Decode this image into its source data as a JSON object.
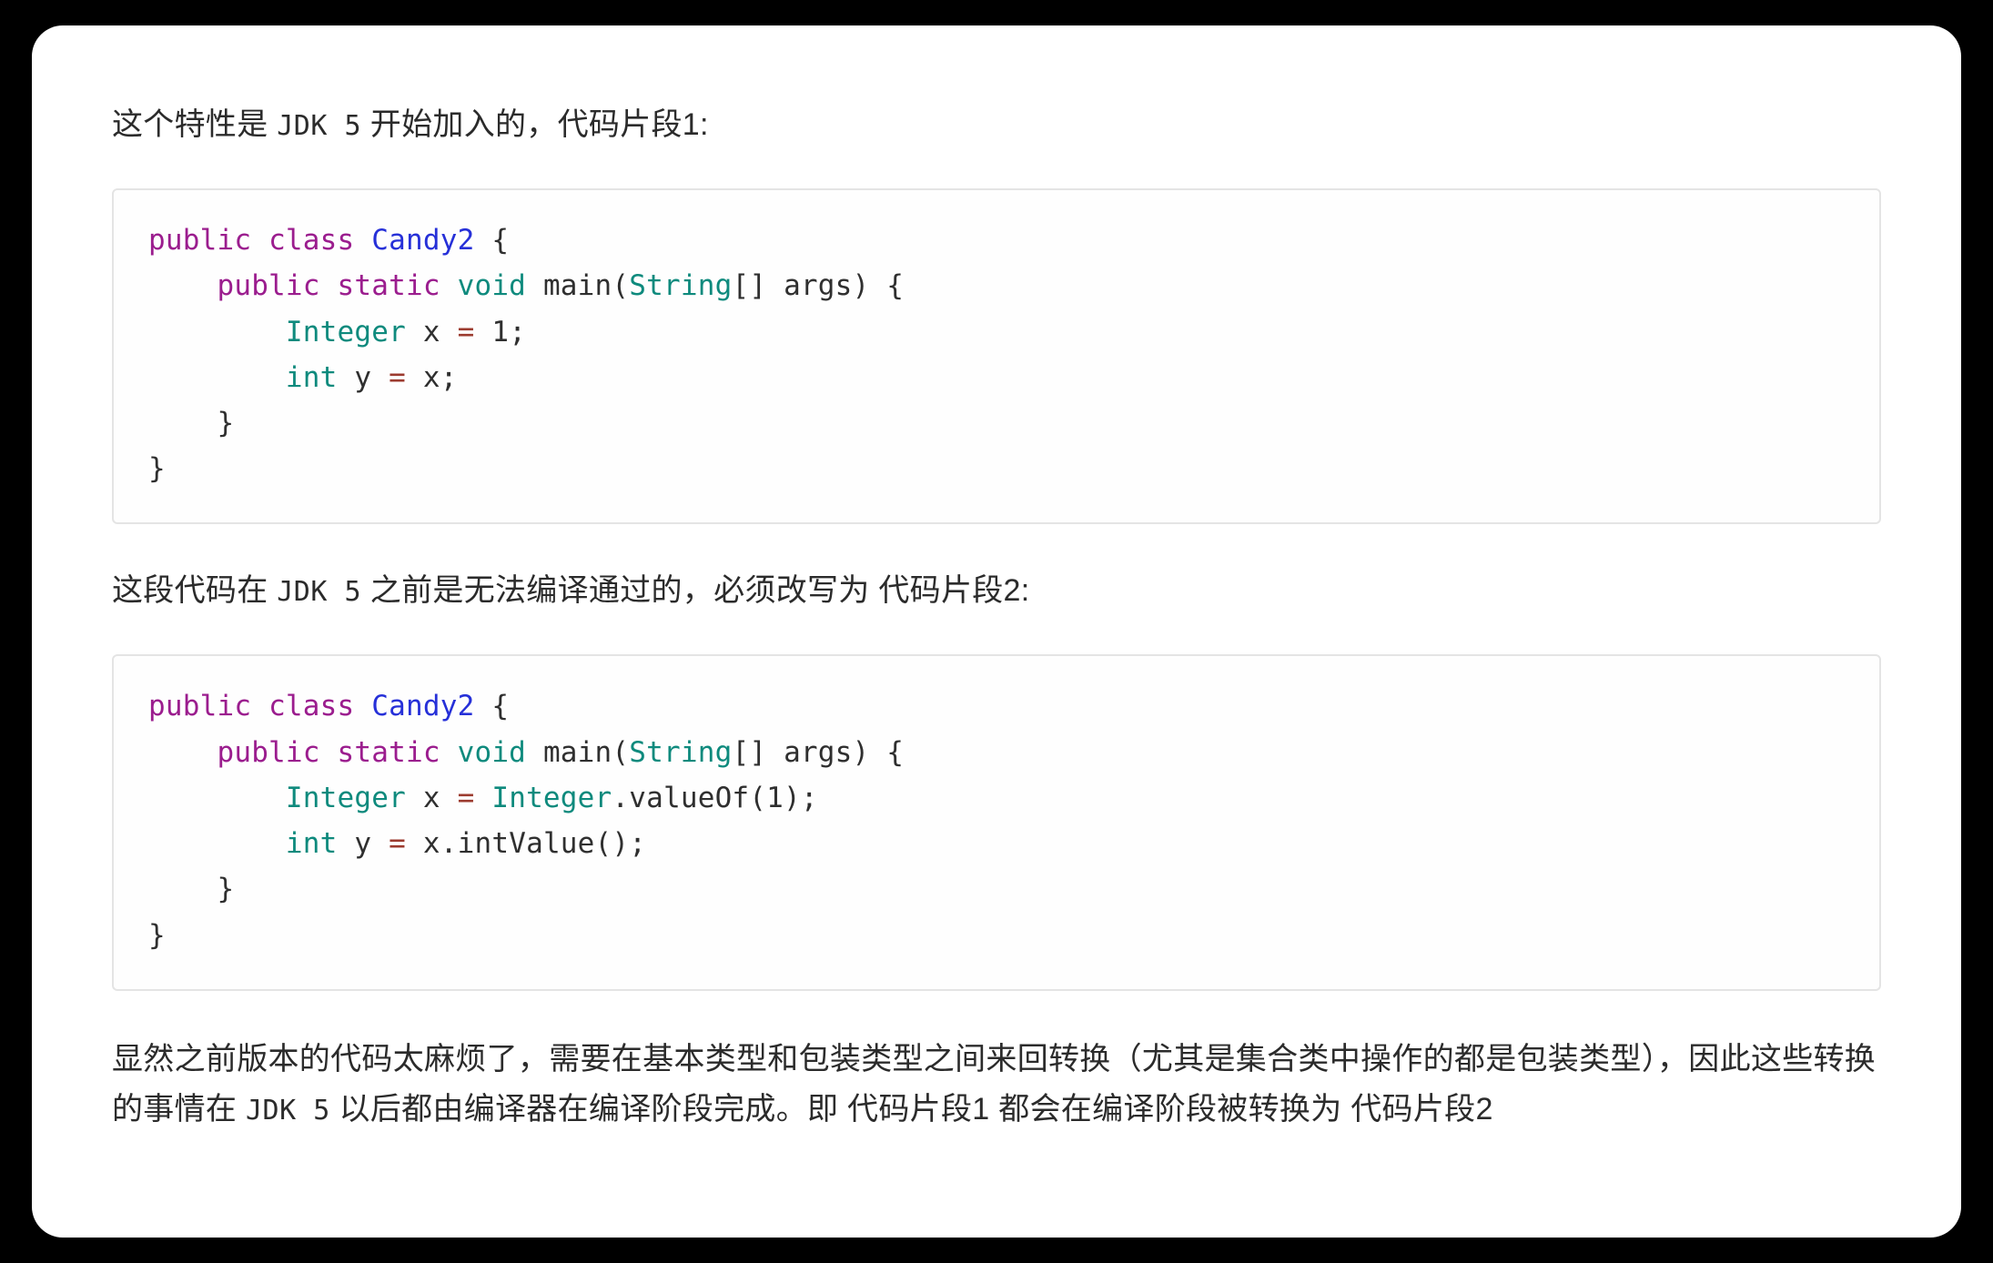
{
  "page": {
    "background_color": "#000000",
    "card_color": "#ffffff"
  },
  "paragraphs": {
    "intro": {
      "part1": "这个特性是 ",
      "mono1": "JDK 5",
      "part2": " 开始加入的，代码片段1:"
    },
    "middle": {
      "part1": "这段代码在 ",
      "mono1": "JDK 5",
      "part2": " 之前是无法编译通过的，必须改写为 代码片段2:"
    },
    "last": {
      "part1": "显然之前版本的代码太麻烦了，需要在基本类型和包装类型之间来回转换（尤其是集合类中操作的都是包装类型），因此这些转换的事情在 ",
      "mono1": "JDK 5",
      "part2": " 以后都由编译器在编译阶段完成。即 代码片段1 都会在编译阶段被转换为 代码片段2"
    }
  },
  "code_block_1": {
    "language": "java",
    "lines": [
      [
        {
          "t": "public",
          "c": "kw"
        },
        {
          "t": " ",
          "c": "plain"
        },
        {
          "t": "class",
          "c": "kw"
        },
        {
          "t": " ",
          "c": "plain"
        },
        {
          "t": "Candy2",
          "c": "cls"
        },
        {
          "t": " {",
          "c": "plain"
        }
      ],
      [
        {
          "t": "    ",
          "c": "plain"
        },
        {
          "t": "public",
          "c": "kw"
        },
        {
          "t": " ",
          "c": "plain"
        },
        {
          "t": "static",
          "c": "kw"
        },
        {
          "t": " ",
          "c": "plain"
        },
        {
          "t": "void",
          "c": "type"
        },
        {
          "t": " ",
          "c": "plain"
        },
        {
          "t": "main",
          "c": "plain"
        },
        {
          "t": "(",
          "c": "plain"
        },
        {
          "t": "String",
          "c": "type"
        },
        {
          "t": "[] ",
          "c": "plain"
        },
        {
          "t": "args",
          "c": "plain"
        },
        {
          "t": ") {",
          "c": "plain"
        }
      ],
      [
        {
          "t": "        ",
          "c": "plain"
        },
        {
          "t": "Integer",
          "c": "type"
        },
        {
          "t": " ",
          "c": "plain"
        },
        {
          "t": "x",
          "c": "plain"
        },
        {
          "t": " ",
          "c": "plain"
        },
        {
          "t": "=",
          "c": "op"
        },
        {
          "t": " ",
          "c": "plain"
        },
        {
          "t": "1",
          "c": "num"
        },
        {
          "t": ";",
          "c": "plain"
        }
      ],
      [
        {
          "t": "        ",
          "c": "plain"
        },
        {
          "t": "int",
          "c": "type"
        },
        {
          "t": " ",
          "c": "plain"
        },
        {
          "t": "y",
          "c": "plain"
        },
        {
          "t": " ",
          "c": "plain"
        },
        {
          "t": "=",
          "c": "op"
        },
        {
          "t": " ",
          "c": "plain"
        },
        {
          "t": "x",
          "c": "plain"
        },
        {
          "t": ";",
          "c": "plain"
        }
      ],
      [
        {
          "t": "    }",
          "c": "plain"
        }
      ],
      [
        {
          "t": "}",
          "c": "plain"
        }
      ]
    ]
  },
  "code_block_2": {
    "language": "java",
    "lines": [
      [
        {
          "t": "public",
          "c": "kw"
        },
        {
          "t": " ",
          "c": "plain"
        },
        {
          "t": "class",
          "c": "kw"
        },
        {
          "t": " ",
          "c": "plain"
        },
        {
          "t": "Candy2",
          "c": "cls"
        },
        {
          "t": " {",
          "c": "plain"
        }
      ],
      [
        {
          "t": "    ",
          "c": "plain"
        },
        {
          "t": "public",
          "c": "kw"
        },
        {
          "t": " ",
          "c": "plain"
        },
        {
          "t": "static",
          "c": "kw"
        },
        {
          "t": " ",
          "c": "plain"
        },
        {
          "t": "void",
          "c": "type"
        },
        {
          "t": " ",
          "c": "plain"
        },
        {
          "t": "main",
          "c": "plain"
        },
        {
          "t": "(",
          "c": "plain"
        },
        {
          "t": "String",
          "c": "type"
        },
        {
          "t": "[] ",
          "c": "plain"
        },
        {
          "t": "args",
          "c": "plain"
        },
        {
          "t": ") {",
          "c": "plain"
        }
      ],
      [
        {
          "t": "        ",
          "c": "plain"
        },
        {
          "t": "Integer",
          "c": "type"
        },
        {
          "t": " ",
          "c": "plain"
        },
        {
          "t": "x",
          "c": "plain"
        },
        {
          "t": " ",
          "c": "plain"
        },
        {
          "t": "=",
          "c": "op"
        },
        {
          "t": " ",
          "c": "plain"
        },
        {
          "t": "Integer",
          "c": "type"
        },
        {
          "t": ".valueOf(",
          "c": "plain"
        },
        {
          "t": "1",
          "c": "num"
        },
        {
          "t": ");",
          "c": "plain"
        }
      ],
      [
        {
          "t": "        ",
          "c": "plain"
        },
        {
          "t": "int",
          "c": "type"
        },
        {
          "t": " ",
          "c": "plain"
        },
        {
          "t": "y",
          "c": "plain"
        },
        {
          "t": " ",
          "c": "plain"
        },
        {
          "t": "=",
          "c": "op"
        },
        {
          "t": " ",
          "c": "plain"
        },
        {
          "t": "x",
          "c": "plain"
        },
        {
          "t": ".intValue();",
          "c": "plain"
        }
      ],
      [
        {
          "t": "    }",
          "c": "plain"
        }
      ],
      [
        {
          "t": "}",
          "c": "plain"
        }
      ]
    ]
  },
  "colors": {
    "keyword": "#9b1d8e",
    "class_name": "#2630d8",
    "type_name": "#0e8a7d",
    "operator": "#9c3b2f",
    "plain": "#2f2f2f",
    "code_border": "#e4e4e4",
    "text": "#2b2b2b"
  }
}
